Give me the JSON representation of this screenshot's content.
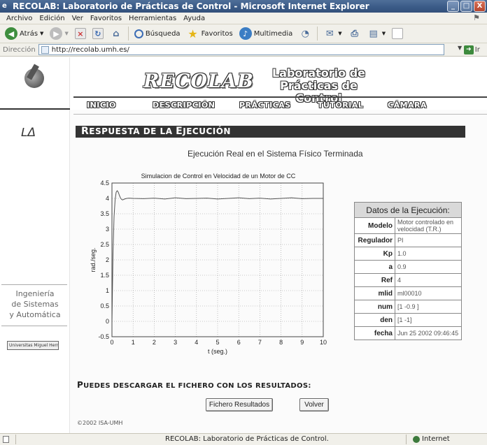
{
  "window": {
    "title": "RECOLAB: Laboratorio de Prácticas de Control - Microsoft Internet Explorer",
    "controls": [
      "_",
      "□",
      "X"
    ]
  },
  "menu": [
    "Archivo",
    "Edición",
    "Ver",
    "Favoritos",
    "Herramientas",
    "Ayuda"
  ],
  "toolbar": {
    "back_label": "Atrás",
    "search_label": "Búsqueda",
    "favorites_label": "Favoritos",
    "media_label": "Multimedia"
  },
  "address": {
    "label": "Dirección",
    "url": "http://recolab.umh.es/",
    "go_label": "Ir"
  },
  "left": {
    "eng_line1": "Ingeniería",
    "eng_line2": "de Sistemas",
    "eng_line3": "y Automática",
    "umh_text": "Universitas Miguel Hernández"
  },
  "header": {
    "brand": "RECOLAB",
    "lab_line1": "Laboratorio de",
    "lab_line2": "Prácticas de Control"
  },
  "nav": [
    "INICIO",
    "DESCRIPCIÓN",
    "PRÁCTICAS",
    "TUTORIAL",
    "CÁMARA"
  ],
  "section": {
    "title_first": "R",
    "title_rest": "ESPUESTA DE LA ",
    "title_first2": "E",
    "title_rest2": "JECUCIÓN",
    "subtitle": "Ejecución Real en el Sistema Físico Terminada"
  },
  "chart_data": {
    "type": "line",
    "title": "Simulacion de Control en Velocidad de un Motor de CC",
    "xlabel": "t (seg.)",
    "ylabel": "rad./seg.",
    "xlim": [
      0,
      10
    ],
    "ylim": [
      -0.5,
      4.5
    ],
    "xticks": [
      0,
      1,
      2,
      3,
      4,
      5,
      6,
      7,
      8,
      9,
      10
    ],
    "yticks": [
      -0.5,
      0,
      0.5,
      1,
      1.5,
      2,
      2.5,
      3,
      3.5,
      4,
      4.5
    ],
    "ytick_labels": [
      "-0.5",
      "0",
      "0.5",
      "1",
      "1.5",
      "2",
      "2.5",
      "3",
      "3.5",
      "4",
      "4.5"
    ],
    "grid": true,
    "series": [
      {
        "x": [
          0,
          0.05,
          0.1,
          0.15,
          0.2,
          0.25,
          0.3,
          0.35,
          0.4,
          0.45,
          0.5,
          0.6,
          0.7,
          0.8,
          1.0,
          1.5,
          2,
          2.5,
          3,
          3.5,
          4,
          4.5,
          5,
          5.5,
          6,
          6.5,
          7,
          7.5,
          8,
          8.5,
          9,
          9.5,
          10
        ],
        "y": [
          0,
          2.2,
          3.4,
          3.95,
          4.2,
          4.25,
          4.2,
          4.1,
          4.02,
          3.97,
          3.95,
          3.98,
          4.0,
          4.01,
          4.0,
          3.99,
          4.01,
          3.98,
          4.02,
          3.99,
          4.0,
          4.01,
          3.98,
          4.0,
          4.02,
          3.99,
          4.01,
          3.98,
          4.0,
          4.02,
          3.99,
          4.0,
          4.0
        ],
        "color": "#555555"
      }
    ]
  },
  "table": {
    "header": "Datos de la Ejecución:",
    "rows": [
      {
        "key": "Modelo",
        "value": "Motor controlado en velocidad (T.R.)"
      },
      {
        "key": "Regulador",
        "value": "PI"
      },
      {
        "key": "Kp",
        "value": "1.0"
      },
      {
        "key": "a",
        "value": "0.9"
      },
      {
        "key": "Ref",
        "value": "4"
      },
      {
        "key": "mlid",
        "value": "ml00010"
      },
      {
        "key": "num",
        "value": "[1 -0.9 ]"
      },
      {
        "key": "den",
        "value": "[1 -1]"
      },
      {
        "key": "fecha",
        "value": "Jun 25 2002 09:46:45"
      }
    ]
  },
  "download": {
    "first": "P",
    "rest": "UEDES DESCARGAR EL FICHERO CON LOS RESULTADOS:",
    "file_button": "Fichero Resultados",
    "back_button": "Volver"
  },
  "copyright": "©2002 ISA-UMH",
  "status": {
    "message": "RECOLAB: Laboratorio de Prácticas de Control.",
    "zone": "Internet"
  }
}
